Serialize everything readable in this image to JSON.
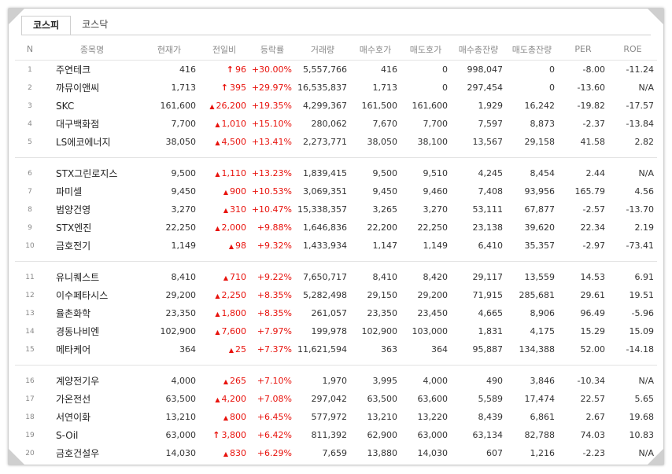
{
  "tabs": [
    "코스피",
    "코스닥"
  ],
  "active_tab": 0,
  "columns": [
    "N",
    "종목명",
    "현재가",
    "전일비",
    "등락률",
    "거래량",
    "매수호가",
    "매도호가",
    "매수총잔량",
    "매도총잔량",
    "PER",
    "ROE"
  ],
  "colors": {
    "up": "#e8120c",
    "header": "#8a8a8a"
  },
  "rows": [
    {
      "n": "1",
      "name": "주연테크",
      "price": "416",
      "change_icon": "upper-limit-arrow-icon",
      "change": "96",
      "rate": "+30.00%",
      "volume": "5,557,766",
      "bid": "416",
      "ask": "0",
      "bid_qty": "998,047",
      "ask_qty": "0",
      "per": "-8.00",
      "roe": "-11.24"
    },
    {
      "n": "2",
      "name": "까뮤이앤씨",
      "price": "1,713",
      "change_icon": "upper-limit-arrow-icon",
      "change": "395",
      "rate": "+29.97%",
      "volume": "16,535,837",
      "bid": "1,713",
      "ask": "0",
      "bid_qty": "297,454",
      "ask_qty": "0",
      "per": "-13.60",
      "roe": "N/A"
    },
    {
      "n": "3",
      "name": "SKC",
      "price": "161,600",
      "change_icon": "rise-triangle-icon",
      "change": "26,200",
      "rate": "+19.35%",
      "volume": "4,299,367",
      "bid": "161,500",
      "ask": "161,600",
      "bid_qty": "1,929",
      "ask_qty": "16,242",
      "per": "-19.82",
      "roe": "-17.57"
    },
    {
      "n": "4",
      "name": "대구백화점",
      "price": "7,700",
      "change_icon": "rise-triangle-icon",
      "change": "1,010",
      "rate": "+15.10%",
      "volume": "280,062",
      "bid": "7,670",
      "ask": "7,700",
      "bid_qty": "7,597",
      "ask_qty": "8,873",
      "per": "-2.37",
      "roe": "-13.84"
    },
    {
      "n": "5",
      "name": "LS에코에너지",
      "price": "38,050",
      "change_icon": "rise-triangle-icon",
      "change": "4,500",
      "rate": "+13.41%",
      "volume": "2,273,771",
      "bid": "38,050",
      "ask": "38,100",
      "bid_qty": "13,567",
      "ask_qty": "29,158",
      "per": "41.58",
      "roe": "2.82"
    },
    {
      "n": "6",
      "name": "STX그린로지스",
      "price": "9,500",
      "change_icon": "rise-triangle-icon",
      "change": "1,110",
      "rate": "+13.23%",
      "volume": "1,839,415",
      "bid": "9,500",
      "ask": "9,510",
      "bid_qty": "4,245",
      "ask_qty": "8,454",
      "per": "2.44",
      "roe": "N/A"
    },
    {
      "n": "7",
      "name": "파미셀",
      "price": "9,450",
      "change_icon": "rise-triangle-icon",
      "change": "900",
      "rate": "+10.53%",
      "volume": "3,069,351",
      "bid": "9,450",
      "ask": "9,460",
      "bid_qty": "7,408",
      "ask_qty": "93,956",
      "per": "165.79",
      "roe": "4.56"
    },
    {
      "n": "8",
      "name": "범양건영",
      "price": "3,270",
      "change_icon": "rise-triangle-icon",
      "change": "310",
      "rate": "+10.47%",
      "volume": "15,338,357",
      "bid": "3,265",
      "ask": "3,270",
      "bid_qty": "53,111",
      "ask_qty": "67,877",
      "per": "-2.57",
      "roe": "-13.70"
    },
    {
      "n": "9",
      "name": "STX엔진",
      "price": "22,250",
      "change_icon": "rise-triangle-icon",
      "change": "2,000",
      "rate": "+9.88%",
      "volume": "1,646,836",
      "bid": "22,200",
      "ask": "22,250",
      "bid_qty": "23,138",
      "ask_qty": "39,620",
      "per": "22.34",
      "roe": "2.19"
    },
    {
      "n": "10",
      "name": "금호전기",
      "price": "1,149",
      "change_icon": "rise-triangle-icon",
      "change": "98",
      "rate": "+9.32%",
      "volume": "1,433,934",
      "bid": "1,147",
      "ask": "1,149",
      "bid_qty": "6,410",
      "ask_qty": "35,357",
      "per": "-2.97",
      "roe": "-73.41"
    },
    {
      "n": "11",
      "name": "유니퀘스트",
      "price": "8,410",
      "change_icon": "rise-triangle-icon",
      "change": "710",
      "rate": "+9.22%",
      "volume": "7,650,717",
      "bid": "8,410",
      "ask": "8,420",
      "bid_qty": "29,117",
      "ask_qty": "13,559",
      "per": "14.53",
      "roe": "6.91"
    },
    {
      "n": "12",
      "name": "이수페타시스",
      "price": "29,200",
      "change_icon": "rise-triangle-icon",
      "change": "2,250",
      "rate": "+8.35%",
      "volume": "5,282,498",
      "bid": "29,150",
      "ask": "29,200",
      "bid_qty": "71,915",
      "ask_qty": "285,681",
      "per": "29.61",
      "roe": "19.51"
    },
    {
      "n": "13",
      "name": "율촌화학",
      "price": "23,350",
      "change_icon": "rise-triangle-icon",
      "change": "1,800",
      "rate": "+8.35%",
      "volume": "261,057",
      "bid": "23,350",
      "ask": "23,450",
      "bid_qty": "4,665",
      "ask_qty": "8,906",
      "per": "96.49",
      "roe": "-5.96"
    },
    {
      "n": "14",
      "name": "경동나비엔",
      "price": "102,900",
      "change_icon": "rise-triangle-icon",
      "change": "7,600",
      "rate": "+7.97%",
      "volume": "199,978",
      "bid": "102,900",
      "ask": "103,000",
      "bid_qty": "1,831",
      "ask_qty": "4,175",
      "per": "15.29",
      "roe": "15.09"
    },
    {
      "n": "15",
      "name": "메타케어",
      "price": "364",
      "change_icon": "rise-triangle-icon",
      "change": "25",
      "rate": "+7.37%",
      "volume": "11,621,594",
      "bid": "363",
      "ask": "364",
      "bid_qty": "95,887",
      "ask_qty": "134,388",
      "per": "52.00",
      "roe": "-14.18"
    },
    {
      "n": "16",
      "name": "계양전기우",
      "price": "4,000",
      "change_icon": "rise-triangle-icon",
      "change": "265",
      "rate": "+7.10%",
      "volume": "1,970",
      "bid": "3,995",
      "ask": "4,000",
      "bid_qty": "490",
      "ask_qty": "3,846",
      "per": "-10.34",
      "roe": "N/A"
    },
    {
      "n": "17",
      "name": "가온전선",
      "price": "63,500",
      "change_icon": "rise-triangle-icon",
      "change": "4,200",
      "rate": "+7.08%",
      "volume": "297,042",
      "bid": "63,500",
      "ask": "63,600",
      "bid_qty": "5,589",
      "ask_qty": "17,474",
      "per": "22.57",
      "roe": "5.65"
    },
    {
      "n": "18",
      "name": "서연이화",
      "price": "13,210",
      "change_icon": "rise-triangle-icon",
      "change": "800",
      "rate": "+6.45%",
      "volume": "577,972",
      "bid": "13,210",
      "ask": "13,220",
      "bid_qty": "8,439",
      "ask_qty": "6,861",
      "per": "2.67",
      "roe": "19.68"
    },
    {
      "n": "19",
      "name": "S-Oil",
      "price": "63,000",
      "change_icon": "upper-limit-arrow-icon",
      "change": "3,800",
      "rate": "+6.42%",
      "volume": "811,392",
      "bid": "62,900",
      "ask": "63,000",
      "bid_qty": "63,134",
      "ask_qty": "82,788",
      "per": "74.03",
      "roe": "10.83"
    },
    {
      "n": "20",
      "name": "금호건설우",
      "price": "14,030",
      "change_icon": "rise-triangle-icon",
      "change": "830",
      "rate": "+6.29%",
      "volume": "7,659",
      "bid": "13,880",
      "ask": "14,030",
      "bid_qty": "607",
      "ask_qty": "1,216",
      "per": "-2.23",
      "roe": "N/A"
    }
  ]
}
